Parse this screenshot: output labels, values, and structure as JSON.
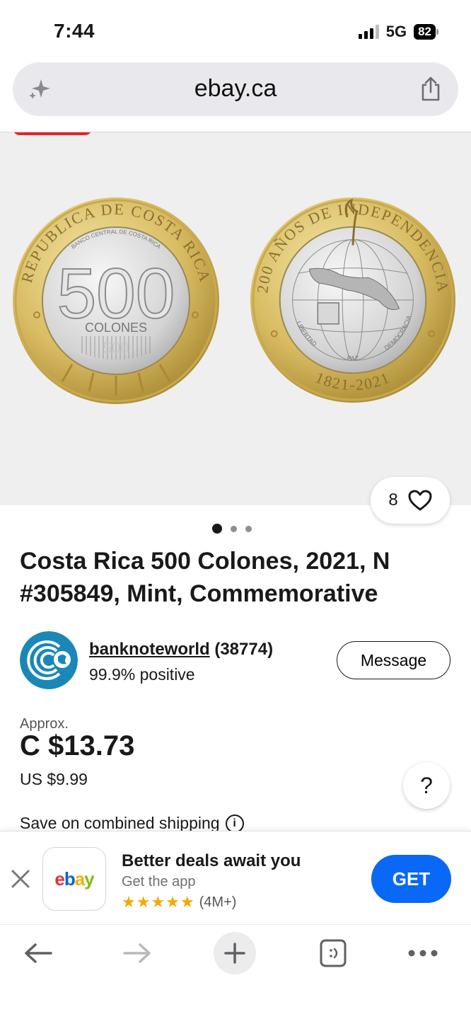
{
  "status_bar": {
    "time": "7:44",
    "network": "5G",
    "battery": "82"
  },
  "browser": {
    "url": "ebay.ca"
  },
  "gallery": {
    "like_count": "8",
    "total_images": 3,
    "active_index": 0
  },
  "listing": {
    "title": "Costa Rica 500 Colones, 2021, N #305849, Mint, Commemorative"
  },
  "coin_obverse": {
    "ring_text": "REPUBLICA DE COSTA RICA",
    "bank_text": "BANCO CENTRAL DE COSTA RICA",
    "value": "500",
    "unit": "COLONES",
    "latent": "500"
  },
  "coin_reverse": {
    "ring_text": "200 AÑOS DE INDEPENDENCIA",
    "motto_left": "LIBERTAD",
    "motto_center": "PAZ",
    "motto_right": "DEMOCRACIA",
    "years": "1821-2021"
  },
  "seller": {
    "name": "banknoteworld",
    "feedback_count": "(38774)",
    "positive": "99.9% positive",
    "message_label": "Message"
  },
  "price": {
    "approx_label": "Approx.",
    "local": "C $13.73",
    "usd": "US $9.99",
    "shipping_note": "Save on combined shipping",
    "help_label": "?"
  },
  "app_banner": {
    "title": "Better deals await you",
    "subtitle": "Get the app",
    "stars": "★★★★★",
    "rating_count": "(4M+)",
    "get_label": "GET",
    "app_icon_text": "ebay"
  },
  "colors": {
    "get_button": "#0968f6",
    "red_tab": "#e0242e",
    "star": "#f4a800"
  },
  "icons": [
    "sparkle-icon",
    "share-icon",
    "heart-icon",
    "info-icon",
    "close-icon",
    "back-arrow-icon",
    "forward-arrow-icon",
    "plus-icon",
    "tabs-icon",
    "more-icon"
  ]
}
